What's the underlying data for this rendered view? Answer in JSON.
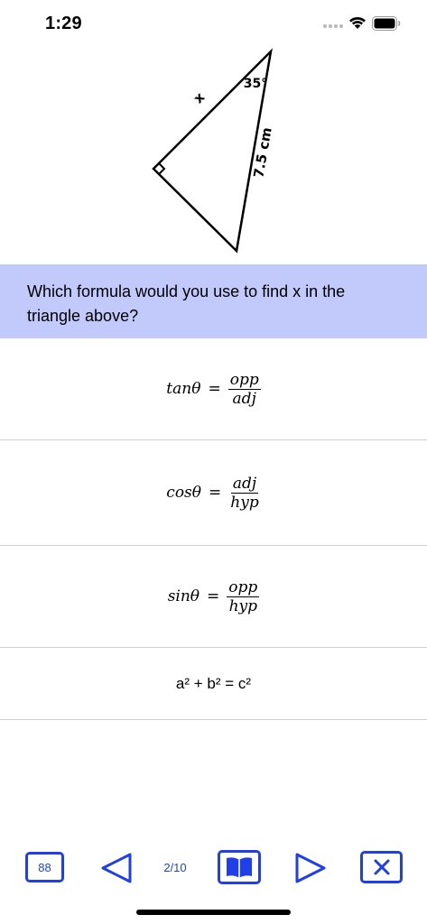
{
  "status_bar": {
    "time": "1:29"
  },
  "diagram": {
    "side_label": "x",
    "hypotenuse_label": "7.5 cm",
    "angle_label": "35°"
  },
  "question": {
    "text": "Which formula would you use to find x in the triangle above?"
  },
  "answers": [
    {
      "lhs": "tanθ",
      "eq": "=",
      "numerator": "opp",
      "denominator": "adj"
    },
    {
      "lhs": "cosθ",
      "eq": "=",
      "numerator": "adj",
      "denominator": "hyp"
    },
    {
      "lhs": "sinθ",
      "eq": "=",
      "numerator": "opp",
      "denominator": "hyp"
    },
    {
      "text": "a² + b² = c²"
    }
  ],
  "toolbar": {
    "score": "88",
    "page_indicator": "2/10",
    "prev_icon": "triangle-left-icon",
    "book_icon": "open-book-icon",
    "next_icon": "triangle-right-icon",
    "close_icon": "close-x-icon"
  },
  "colors": {
    "accent": "#1f3fea",
    "question_bg": "#c2c9fb",
    "divider": "#cfcfcf"
  }
}
